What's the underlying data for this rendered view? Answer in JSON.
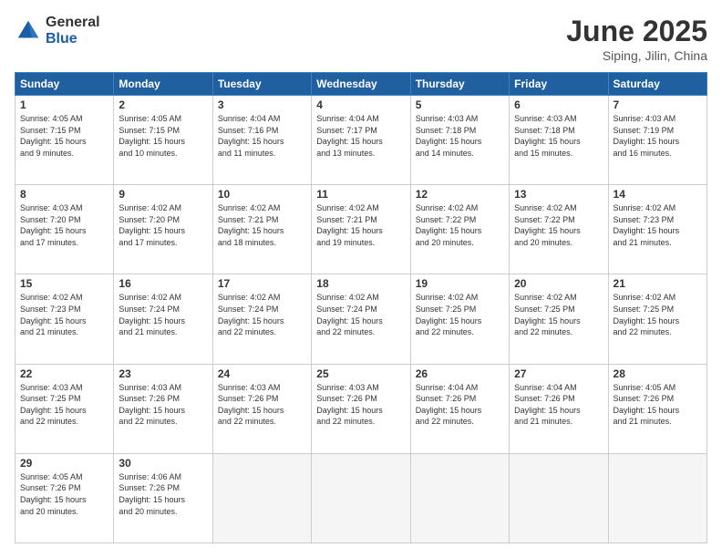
{
  "logo": {
    "general": "General",
    "blue": "Blue"
  },
  "header": {
    "month": "June 2025",
    "location": "Siping, Jilin, China"
  },
  "weekdays": [
    "Sunday",
    "Monday",
    "Tuesday",
    "Wednesday",
    "Thursday",
    "Friday",
    "Saturday"
  ],
  "weeks": [
    [
      {
        "day": "1",
        "info": "Sunrise: 4:05 AM\nSunset: 7:15 PM\nDaylight: 15 hours\nand 9 minutes."
      },
      {
        "day": "2",
        "info": "Sunrise: 4:05 AM\nSunset: 7:15 PM\nDaylight: 15 hours\nand 10 minutes."
      },
      {
        "day": "3",
        "info": "Sunrise: 4:04 AM\nSunset: 7:16 PM\nDaylight: 15 hours\nand 11 minutes."
      },
      {
        "day": "4",
        "info": "Sunrise: 4:04 AM\nSunset: 7:17 PM\nDaylight: 15 hours\nand 13 minutes."
      },
      {
        "day": "5",
        "info": "Sunrise: 4:03 AM\nSunset: 7:18 PM\nDaylight: 15 hours\nand 14 minutes."
      },
      {
        "day": "6",
        "info": "Sunrise: 4:03 AM\nSunset: 7:18 PM\nDaylight: 15 hours\nand 15 minutes."
      },
      {
        "day": "7",
        "info": "Sunrise: 4:03 AM\nSunset: 7:19 PM\nDaylight: 15 hours\nand 16 minutes."
      }
    ],
    [
      {
        "day": "8",
        "info": "Sunrise: 4:03 AM\nSunset: 7:20 PM\nDaylight: 15 hours\nand 17 minutes."
      },
      {
        "day": "9",
        "info": "Sunrise: 4:02 AM\nSunset: 7:20 PM\nDaylight: 15 hours\nand 17 minutes."
      },
      {
        "day": "10",
        "info": "Sunrise: 4:02 AM\nSunset: 7:21 PM\nDaylight: 15 hours\nand 18 minutes."
      },
      {
        "day": "11",
        "info": "Sunrise: 4:02 AM\nSunset: 7:21 PM\nDaylight: 15 hours\nand 19 minutes."
      },
      {
        "day": "12",
        "info": "Sunrise: 4:02 AM\nSunset: 7:22 PM\nDaylight: 15 hours\nand 20 minutes."
      },
      {
        "day": "13",
        "info": "Sunrise: 4:02 AM\nSunset: 7:22 PM\nDaylight: 15 hours\nand 20 minutes."
      },
      {
        "day": "14",
        "info": "Sunrise: 4:02 AM\nSunset: 7:23 PM\nDaylight: 15 hours\nand 21 minutes."
      }
    ],
    [
      {
        "day": "15",
        "info": "Sunrise: 4:02 AM\nSunset: 7:23 PM\nDaylight: 15 hours\nand 21 minutes."
      },
      {
        "day": "16",
        "info": "Sunrise: 4:02 AM\nSunset: 7:24 PM\nDaylight: 15 hours\nand 21 minutes."
      },
      {
        "day": "17",
        "info": "Sunrise: 4:02 AM\nSunset: 7:24 PM\nDaylight: 15 hours\nand 22 minutes."
      },
      {
        "day": "18",
        "info": "Sunrise: 4:02 AM\nSunset: 7:24 PM\nDaylight: 15 hours\nand 22 minutes."
      },
      {
        "day": "19",
        "info": "Sunrise: 4:02 AM\nSunset: 7:25 PM\nDaylight: 15 hours\nand 22 minutes."
      },
      {
        "day": "20",
        "info": "Sunrise: 4:02 AM\nSunset: 7:25 PM\nDaylight: 15 hours\nand 22 minutes."
      },
      {
        "day": "21",
        "info": "Sunrise: 4:02 AM\nSunset: 7:25 PM\nDaylight: 15 hours\nand 22 minutes."
      }
    ],
    [
      {
        "day": "22",
        "info": "Sunrise: 4:03 AM\nSunset: 7:25 PM\nDaylight: 15 hours\nand 22 minutes."
      },
      {
        "day": "23",
        "info": "Sunrise: 4:03 AM\nSunset: 7:26 PM\nDaylight: 15 hours\nand 22 minutes."
      },
      {
        "day": "24",
        "info": "Sunrise: 4:03 AM\nSunset: 7:26 PM\nDaylight: 15 hours\nand 22 minutes."
      },
      {
        "day": "25",
        "info": "Sunrise: 4:03 AM\nSunset: 7:26 PM\nDaylight: 15 hours\nand 22 minutes."
      },
      {
        "day": "26",
        "info": "Sunrise: 4:04 AM\nSunset: 7:26 PM\nDaylight: 15 hours\nand 22 minutes."
      },
      {
        "day": "27",
        "info": "Sunrise: 4:04 AM\nSunset: 7:26 PM\nDaylight: 15 hours\nand 21 minutes."
      },
      {
        "day": "28",
        "info": "Sunrise: 4:05 AM\nSunset: 7:26 PM\nDaylight: 15 hours\nand 21 minutes."
      }
    ],
    [
      {
        "day": "29",
        "info": "Sunrise: 4:05 AM\nSunset: 7:26 PM\nDaylight: 15 hours\nand 20 minutes."
      },
      {
        "day": "30",
        "info": "Sunrise: 4:06 AM\nSunset: 7:26 PM\nDaylight: 15 hours\nand 20 minutes."
      },
      null,
      null,
      null,
      null,
      null
    ]
  ]
}
